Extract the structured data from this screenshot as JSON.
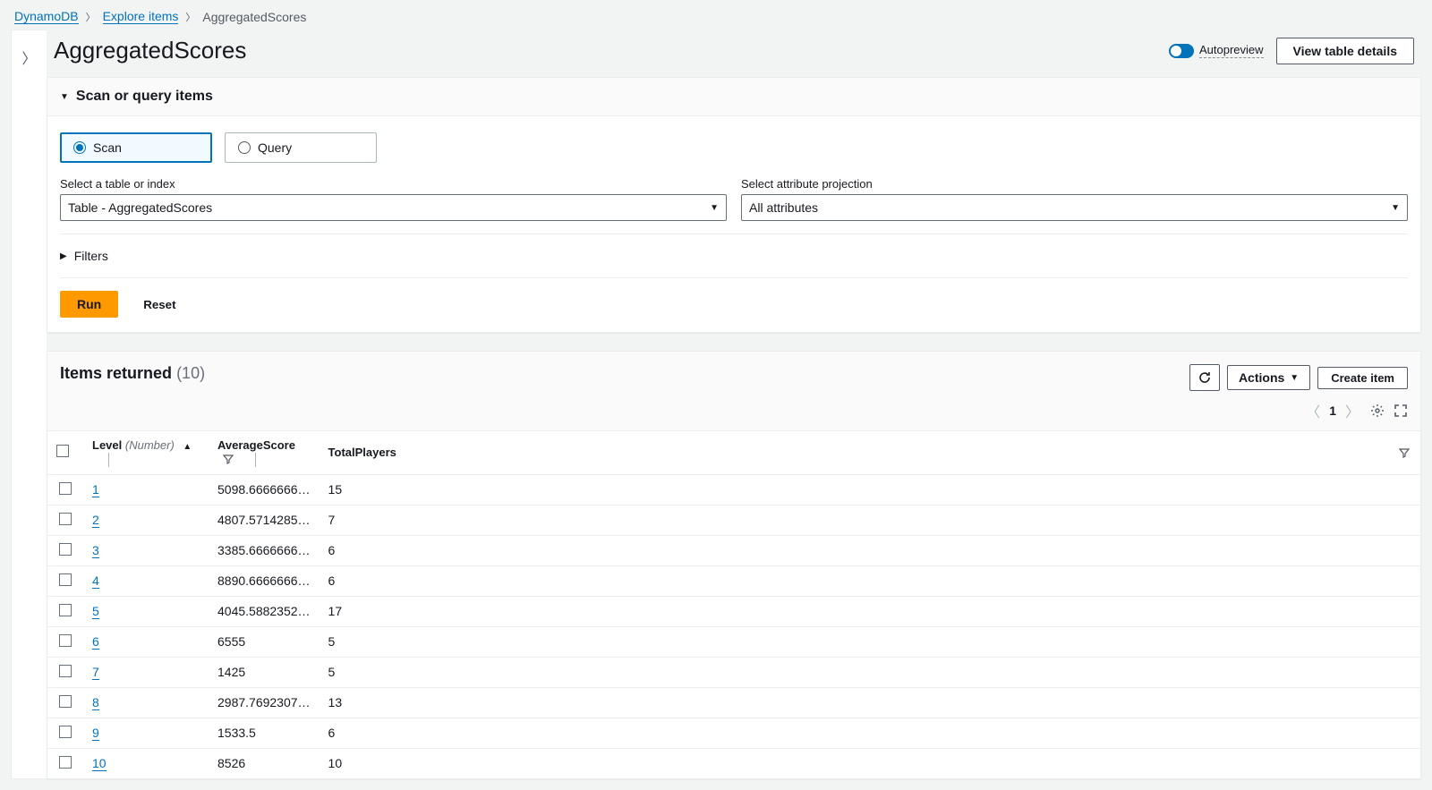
{
  "breadcrumb": {
    "root": "DynamoDB",
    "mid": "Explore items",
    "current": "AggregatedScores"
  },
  "header": {
    "title": "AggregatedScores",
    "autopreview_label": "Autopreview",
    "view_table_details": "View table details"
  },
  "scan_section": {
    "title": "Scan or query items",
    "scan_label": "Scan",
    "query_label": "Query",
    "table_select_label": "Select a table or index",
    "table_select_value": "Table - AggregatedScores",
    "projection_label": "Select attribute projection",
    "projection_value": "All attributes",
    "filters_label": "Filters",
    "run_label": "Run",
    "reset_label": "Reset"
  },
  "items_section": {
    "title": "Items returned",
    "count_display": "(10)",
    "actions_label": "Actions",
    "create_item_label": "Create item",
    "page_number": "1",
    "columns": {
      "level_name": "Level",
      "level_type": "(Number)",
      "avg_name": "AverageScore",
      "total_name": "TotalPlayers"
    },
    "rows": [
      {
        "level": "1",
        "avg": "5098.6666666…",
        "total": "15"
      },
      {
        "level": "2",
        "avg": "4807.5714285…",
        "total": "7"
      },
      {
        "level": "3",
        "avg": "3385.6666666…",
        "total": "6"
      },
      {
        "level": "4",
        "avg": "8890.6666666…",
        "total": "6"
      },
      {
        "level": "5",
        "avg": "4045.5882352…",
        "total": "17"
      },
      {
        "level": "6",
        "avg": "6555",
        "total": "5"
      },
      {
        "level": "7",
        "avg": "1425",
        "total": "5"
      },
      {
        "level": "8",
        "avg": "2987.7692307…",
        "total": "13"
      },
      {
        "level": "9",
        "avg": "1533.5",
        "total": "6"
      },
      {
        "level": "10",
        "avg": "8526",
        "total": "10"
      }
    ]
  }
}
